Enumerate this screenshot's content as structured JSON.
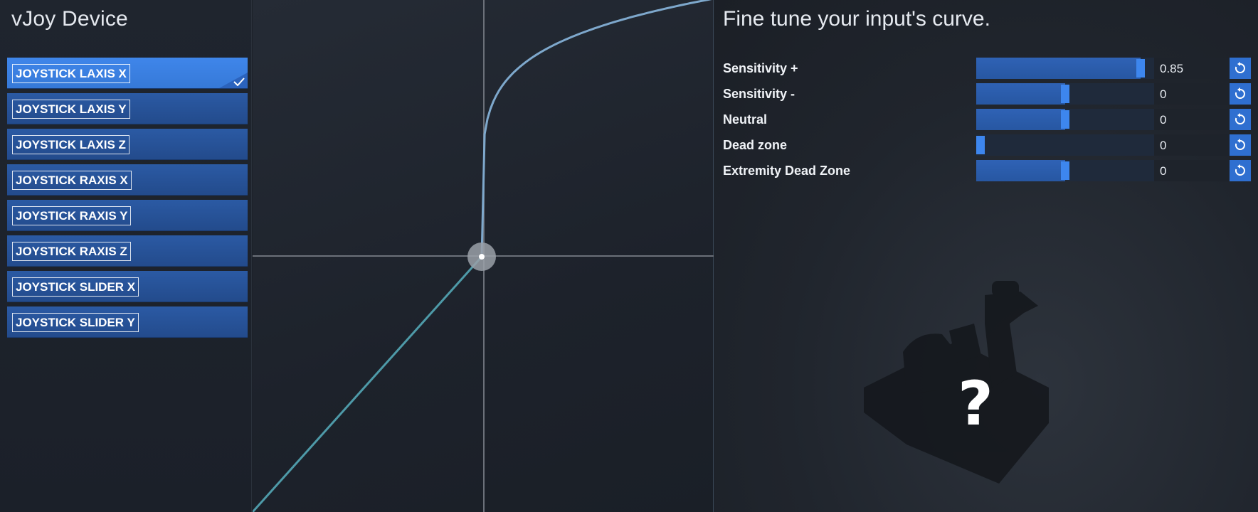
{
  "left_panel": {
    "title": "vJoy Device",
    "axes": [
      {
        "label": "JOYSTICK LAXIS X",
        "selected": true
      },
      {
        "label": "JOYSTICK LAXIS Y",
        "selected": false
      },
      {
        "label": "JOYSTICK LAXIS Z",
        "selected": false
      },
      {
        "label": "JOYSTICK RAXIS X",
        "selected": false
      },
      {
        "label": "JOYSTICK RAXIS Y",
        "selected": false
      },
      {
        "label": "JOYSTICK RAXIS Z",
        "selected": false
      },
      {
        "label": "JOYSTICK SLIDER X",
        "selected": false
      },
      {
        "label": "JOYSTICK SLIDER Y",
        "selected": false
      }
    ]
  },
  "curve": {
    "sensitivity_plus": 0.85,
    "neutral_point_color": "#9aa0a8",
    "positive_curve_color": "#7ea8cc",
    "negative_curve_color": "#4e9aa8"
  },
  "right_panel": {
    "title": "Fine tune your input's curve.",
    "settings": [
      {
        "label": "Sensitivity +",
        "value": "0.85",
        "slider_fraction": 0.925
      },
      {
        "label": "Sensitivity -",
        "value": "0",
        "slider_fraction": 0.5
      },
      {
        "label": "Neutral",
        "value": "0",
        "slider_fraction": 0.5
      },
      {
        "label": "Dead zone",
        "value": "0",
        "slider_fraction": 0.0
      },
      {
        "label": "Extremity Dead Zone",
        "value": "0",
        "slider_fraction": 0.5
      }
    ],
    "reset_icon": "reset-icon",
    "illustration_icon": "joystick-device-icon",
    "unknown_symbol": "?"
  },
  "colors": {
    "accent": "#3d86ee",
    "selected_item": "#3f86ea",
    "item": "#2b5aa4"
  }
}
